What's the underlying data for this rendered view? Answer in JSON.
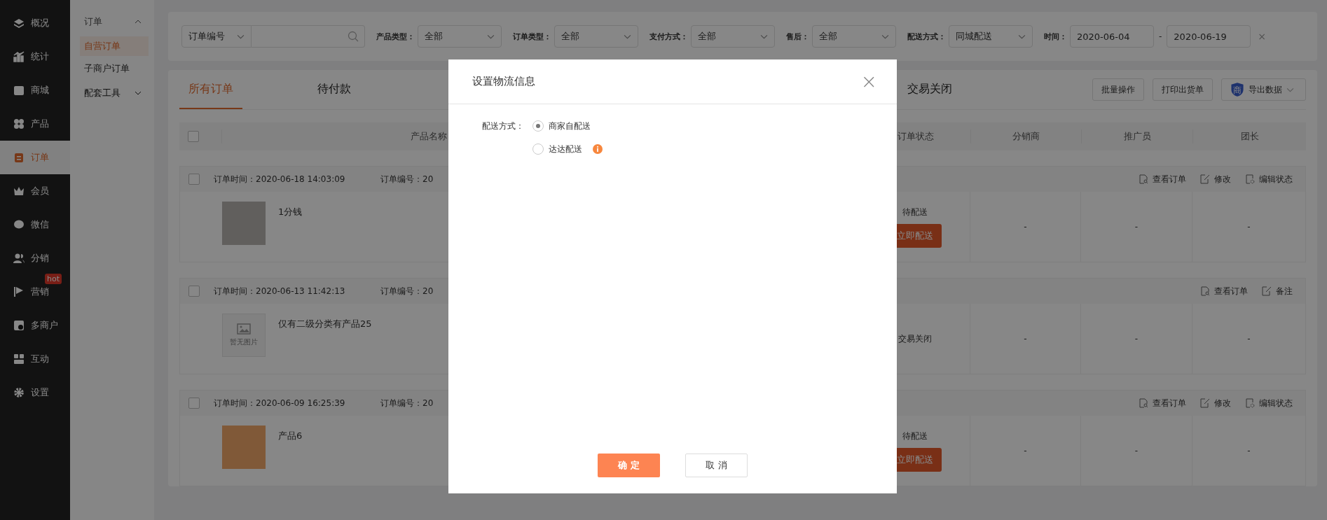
{
  "sidebar": {
    "items": [
      {
        "label": "概况",
        "selected": false
      },
      {
        "label": "统计",
        "selected": false
      },
      {
        "label": "商城",
        "selected": false
      },
      {
        "label": "产品",
        "selected": false
      },
      {
        "label": "订单",
        "selected": true
      },
      {
        "label": "会员",
        "selected": false
      },
      {
        "label": "微信",
        "selected": false
      },
      {
        "label": "分销",
        "selected": false
      },
      {
        "label": "营销",
        "selected": false,
        "badge": "hot"
      },
      {
        "label": "多商户",
        "selected": false
      },
      {
        "label": "互动",
        "selected": false
      },
      {
        "label": "设置",
        "selected": false
      }
    ]
  },
  "submenu": {
    "items": [
      {
        "label": "订单",
        "expanded": true,
        "children": [
          {
            "label": "自营订单",
            "selected": true
          },
          {
            "label": "子商户订单",
            "selected": false
          }
        ]
      },
      {
        "label": "配套工具",
        "expanded": false
      }
    ]
  },
  "filters": {
    "search_type": "订单编号",
    "selects": [
      {
        "label": "产品类型：",
        "value": "全部"
      },
      {
        "label": "订单类型：",
        "value": "全部"
      },
      {
        "label": "支付方式：",
        "value": "全部"
      },
      {
        "label": "售后：",
        "value": "全部"
      },
      {
        "label": "配送方式：",
        "value": "同城配送"
      }
    ],
    "time": {
      "label": "时间：",
      "start": "2020-06-04",
      "separator": "-",
      "end": "2020-06-19",
      "clear": "×"
    }
  },
  "tabs": [
    {
      "label": "所有订单",
      "selected": true
    },
    {
      "label": "待付款",
      "selected": false
    },
    {
      "label": "交易关闭",
      "selected": false
    }
  ],
  "toolbar": {
    "buttons": [
      {
        "label": "批量操作"
      },
      {
        "label": "打印出货单"
      },
      {
        "label": "导出数据",
        "icon_text": "商",
        "dropdown": true
      }
    ]
  },
  "table": {
    "select_all_checked": false,
    "columns": [
      {
        "label": "产品名称"
      },
      {
        "label": "订单状态"
      },
      {
        "label": "分销商"
      },
      {
        "label": "推广员"
      },
      {
        "label": "团长"
      }
    ],
    "orders": [
      {
        "checked": false,
        "time": "订单时间：2020-06-18 14:03:09",
        "number": "订单编号：20",
        "actions": [
          {
            "kind": "view",
            "label": "查看订单"
          },
          {
            "kind": "edit",
            "label": "修改"
          },
          {
            "kind": "status",
            "label": "编辑状态"
          }
        ],
        "product": {
          "name": "1分钱"
        },
        "status": "待配送",
        "status_action": "立即配送",
        "distributor": "-",
        "promoter": "-",
        "leader": "-"
      },
      {
        "checked": false,
        "time": "订单时间：2020-06-13 11:42:13",
        "number": "订单编号：20",
        "actions": [
          {
            "kind": "view",
            "label": "查看订单"
          },
          {
            "kind": "note",
            "label": "备注"
          }
        ],
        "product": {
          "image_text": "暂无图片",
          "name": "仅有二级分类有产品25"
        },
        "status": "交易关闭",
        "distributor": "-",
        "promoter": "-",
        "leader": "-"
      },
      {
        "checked": false,
        "time": "订单时间：2020-06-09 16:25:39",
        "number": "订单编号：20",
        "actions": [
          {
            "kind": "view",
            "label": "查看订单"
          },
          {
            "kind": "edit",
            "label": "修改"
          },
          {
            "kind": "status",
            "label": "编辑状态"
          }
        ],
        "product": {
          "name": "产品6"
        },
        "status": "待配送",
        "status_action": "立即配送",
        "distributor": "-",
        "promoter": "-",
        "leader": "-"
      }
    ]
  },
  "modal": {
    "title": "设置物流信息",
    "close": "×",
    "field_label": "配送方式：",
    "options": [
      {
        "label": "商家自配送",
        "selected": true,
        "info": false
      },
      {
        "label": "达达配送",
        "selected": false,
        "info": true
      }
    ],
    "buttons": [
      {
        "kind": "primary",
        "label": "确 定"
      },
      {
        "kind": "secondary",
        "label": "取 消"
      }
    ]
  }
}
